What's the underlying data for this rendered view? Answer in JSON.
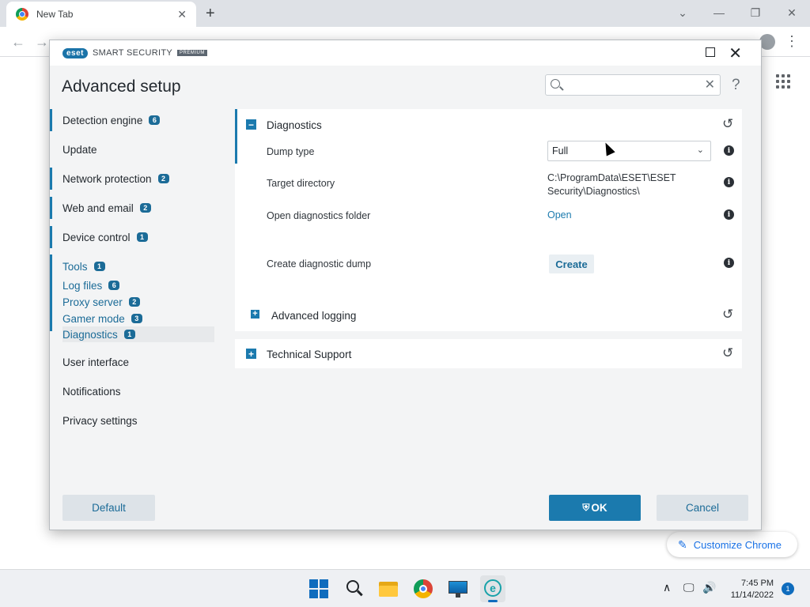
{
  "chrome": {
    "tab_title": "New Tab",
    "tab_close": "✕",
    "new_tab": "+",
    "customize_label": "Customize Chrome"
  },
  "eset": {
    "logo": "eset",
    "product": "SMART SECURITY",
    "edition": "PREMIUM",
    "page_title": "Advanced setup",
    "search_value": "",
    "help": "?",
    "sidebar": {
      "detection_engine": {
        "label": "Detection engine",
        "badge": "6"
      },
      "update": {
        "label": "Update"
      },
      "network_protection": {
        "label": "Network protection",
        "badge": "2"
      },
      "web_and_email": {
        "label": "Web and email",
        "badge": "2"
      },
      "device_control": {
        "label": "Device control",
        "badge": "1"
      },
      "tools": {
        "label": "Tools",
        "badge": "1"
      },
      "log_files": {
        "label": "Log files",
        "badge": "6"
      },
      "proxy_server": {
        "label": "Proxy server",
        "badge": "2"
      },
      "gamer_mode": {
        "label": "Gamer mode",
        "badge": "3"
      },
      "diagnostics": {
        "label": "Diagnostics",
        "badge": "1"
      },
      "user_interface": {
        "label": "User interface"
      },
      "notifications": {
        "label": "Notifications"
      },
      "privacy_settings": {
        "label": "Privacy settings"
      }
    },
    "diagnostics": {
      "title": "Diagnostics",
      "dump_type_label": "Dump type",
      "dump_type_value": "Full",
      "target_directory_label": "Target directory",
      "target_directory_value": "C:\\ProgramData\\ESET\\ESET Security\\Diagnostics\\",
      "open_folder_label": "Open diagnostics folder",
      "open_link": "Open",
      "create_dump_label": "Create diagnostic dump",
      "create_button": "Create"
    },
    "advanced_logging": {
      "title": "Advanced logging"
    },
    "technical_support": {
      "title": "Technical Support"
    },
    "buttons": {
      "default": "Default",
      "ok": "OK",
      "cancel": "Cancel"
    },
    "colors": {
      "accent": "#1b7aae",
      "badge": "#1b6b97",
      "button_secondary": "#dde3e8"
    }
  },
  "taskbar": {
    "time": "7:45 PM",
    "date": "11/14/2022",
    "notification_count": "1"
  }
}
